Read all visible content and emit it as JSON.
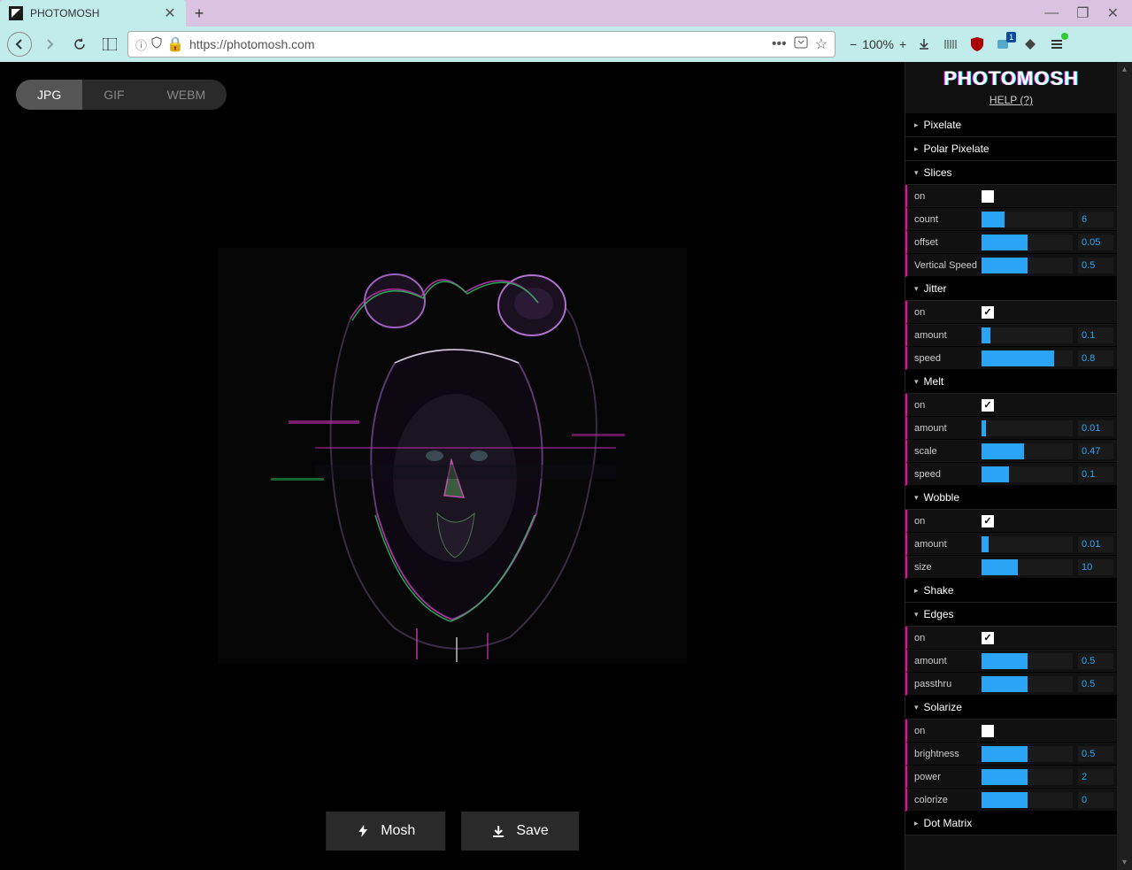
{
  "browser": {
    "tab_title": "PHOTOMOSH",
    "url": "https://photomosh.com",
    "zoom": "100%",
    "ext_badge": "1"
  },
  "app": {
    "logo": "PHOTOMOSH",
    "help": "HELP (?)",
    "format_tabs": {
      "jpg": "JPG",
      "gif": "GIF",
      "webm": "WEBM"
    },
    "buttons": {
      "mosh": "Mosh",
      "save": "Save"
    }
  },
  "effects": {
    "pixelate": {
      "name": "Pixelate"
    },
    "polar_pixelate": {
      "name": "Polar Pixelate"
    },
    "slices": {
      "name": "Slices",
      "on_label": "on",
      "count_label": "count",
      "count_value": "6",
      "offset_label": "offset",
      "offset_value": "0.05",
      "vspeed_label": "Vertical Speed",
      "vspeed_value": "0.5"
    },
    "jitter": {
      "name": "Jitter",
      "on_label": "on",
      "amount_label": "amount",
      "amount_value": "0.1",
      "speed_label": "speed",
      "speed_value": "0.8"
    },
    "melt": {
      "name": "Melt",
      "on_label": "on",
      "amount_label": "amount",
      "amount_value": "0.01",
      "scale_label": "scale",
      "scale_value": "0.47",
      "speed_label": "speed",
      "speed_value": "0.1"
    },
    "wobble": {
      "name": "Wobble",
      "on_label": "on",
      "amount_label": "amount",
      "amount_value": "0.01",
      "size_label": "size",
      "size_value": "10"
    },
    "shake": {
      "name": "Shake"
    },
    "edges": {
      "name": "Edges",
      "on_label": "on",
      "amount_label": "amount",
      "amount_value": "0.5",
      "passthru_label": "passthru",
      "passthru_value": "0.5"
    },
    "solarize": {
      "name": "Solarize",
      "on_label": "on",
      "brightness_label": "brightness",
      "brightness_value": "0.5",
      "power_label": "power",
      "power_value": "2",
      "colorize_label": "colorize",
      "colorize_value": "0"
    },
    "dot_matrix": {
      "name": "Dot Matrix"
    }
  }
}
